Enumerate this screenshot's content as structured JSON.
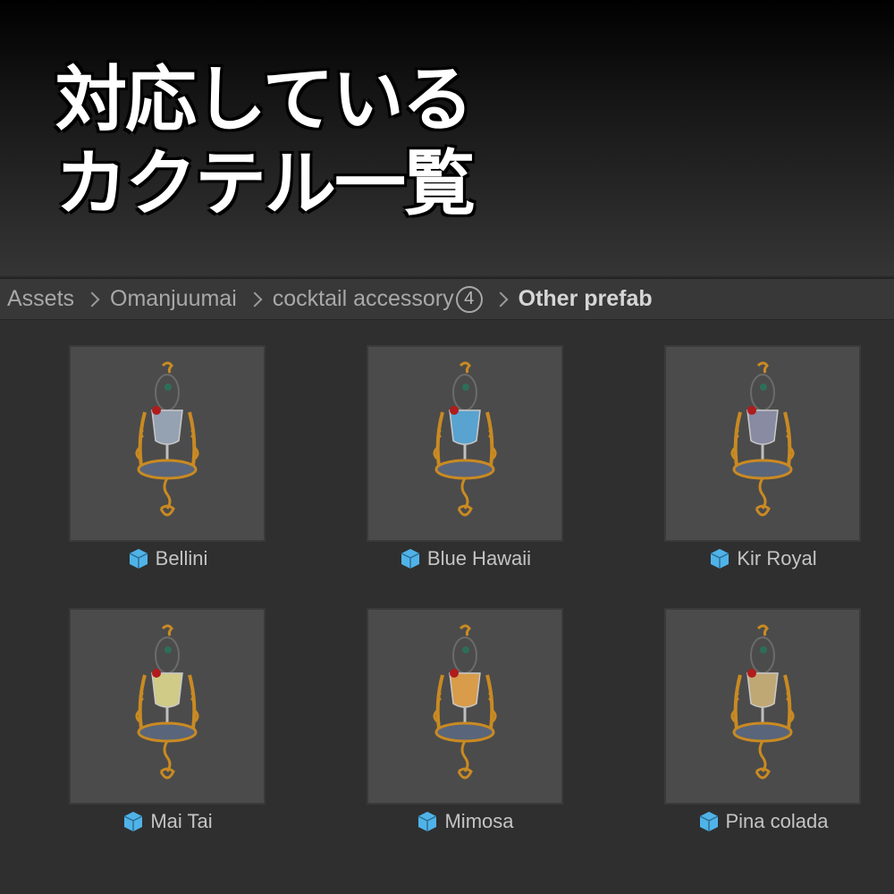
{
  "banner": {
    "line1": "対応している",
    "line2": "カクテル一覧",
    "sparkle": "✦"
  },
  "breadcrumb": {
    "items": [
      "Assets",
      "Omanjuumai",
      "cocktail accessory"
    ],
    "badge": "4",
    "current": "Other prefab"
  },
  "assets": [
    {
      "name": "Bellini",
      "drink_color": "#9aa7b8",
      "icon": "prefab-cube-icon"
    },
    {
      "name": "Blue Hawaii",
      "drink_color": "#5aa8d8",
      "icon": "prefab-cube-icon"
    },
    {
      "name": "Kir Royal",
      "drink_color": "#8c8fa6",
      "icon": "prefab-cube-icon"
    },
    {
      "name": "Mai Tai",
      "drink_color": "#d8d28a",
      "icon": "prefab-cube-icon"
    },
    {
      "name": "Mimosa",
      "drink_color": "#e0a14a",
      "icon": "prefab-cube-icon"
    },
    {
      "name": "Pina colada",
      "drink_color": "#c7ad78",
      "icon": "prefab-cube-icon"
    }
  ],
  "colors": {
    "ornament_gold": "#c98a22",
    "prefab_icon": "#4fb3e8",
    "garnish_red": "#b01c1c"
  }
}
